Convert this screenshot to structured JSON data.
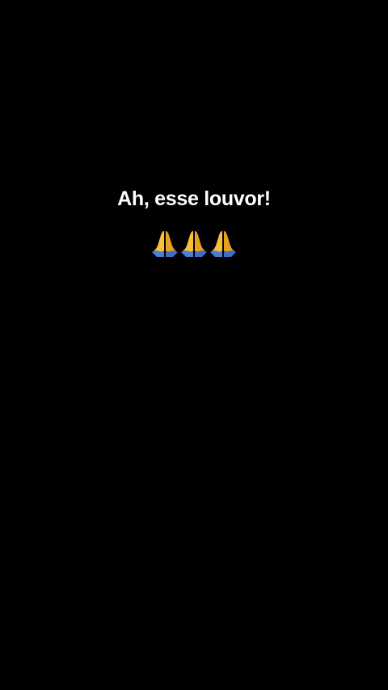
{
  "caption": {
    "text": "Ah, esse louvor!"
  },
  "emojis": {
    "items": [
      "folded-hands-icon",
      "folded-hands-icon",
      "folded-hands-icon"
    ],
    "colors": {
      "hand": "#F7C036",
      "hand_shade": "#E5A21E",
      "sleeve": "#4A7FD9"
    }
  },
  "theme": {
    "background": "#000000",
    "text": "#FFFFFF"
  }
}
